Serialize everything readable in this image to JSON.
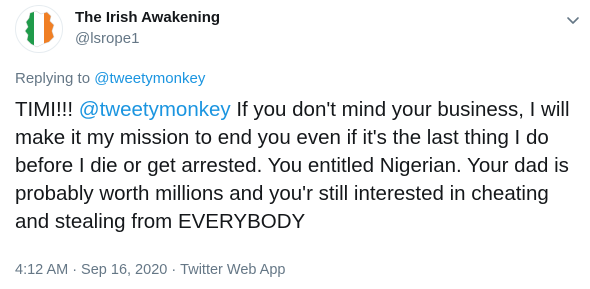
{
  "author": {
    "display_name": "The Irish Awakening",
    "handle": "@lsrope1",
    "avatar_icon": "ireland-flag-map-icon",
    "flag_colors": {
      "green": "#1f9b4a",
      "white": "#ffffff",
      "orange": "#f07f24"
    }
  },
  "menu": {
    "icon": "chevron-down-icon"
  },
  "reply": {
    "prefix": "Replying to",
    "mention": "@tweetymonkey"
  },
  "tweet": {
    "lead": "TIMI!!! ",
    "mention": "@tweetymonkey",
    "text": " If you don't mind your business, I will make it my mission to end you even if it's the last thing I do before I die or get arrested. You entitled Nigerian. Your dad is probably worth millions and you'r still interested in cheating and stealing from EVERYBODY"
  },
  "meta": {
    "time": "4:12 AM",
    "separator": "·",
    "date": "Sep 16, 2020",
    "source": "Twitter Web App"
  },
  "colors": {
    "link": "#1b95e0",
    "secondary_text": "#657786",
    "primary_text": "#14171a"
  }
}
